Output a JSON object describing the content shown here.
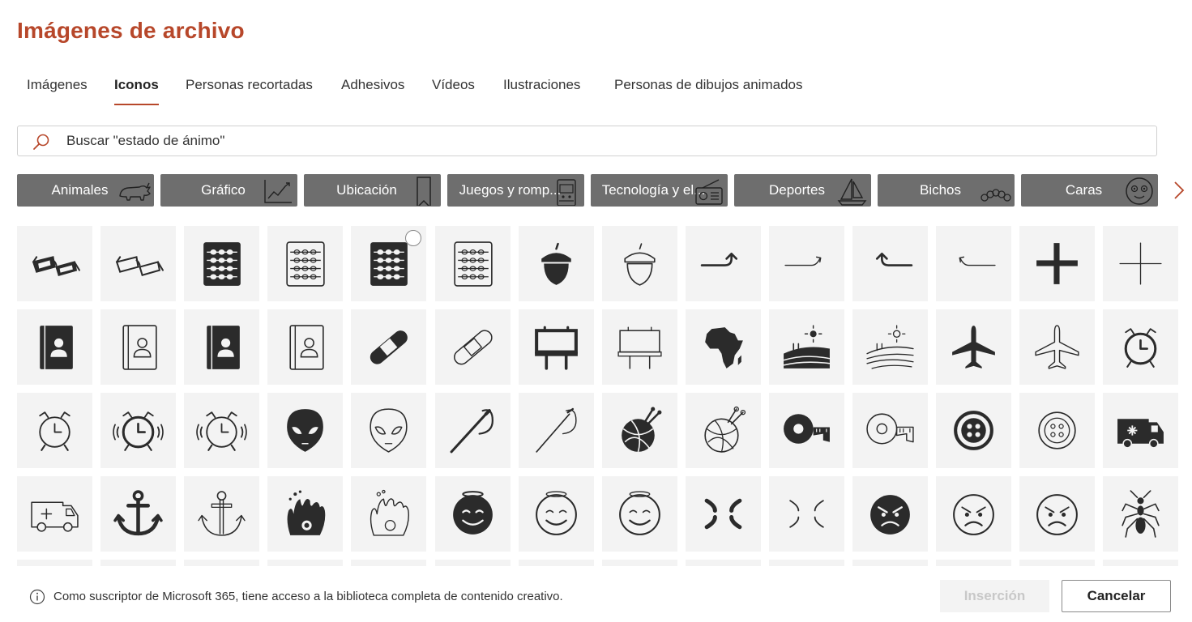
{
  "dialog": {
    "title": "Imágenes de archivo"
  },
  "tabs": [
    {
      "label": "Imágenes",
      "active": false
    },
    {
      "label": "Iconos",
      "active": true
    },
    {
      "label": "Personas recortadas",
      "active": false
    },
    {
      "label": "Adhesivos",
      "active": false
    },
    {
      "label": "Vídeos",
      "active": false
    },
    {
      "label": "Ilustraciones",
      "active": false
    },
    {
      "label": "Personas de dibujos animados",
      "active": false
    }
  ],
  "search": {
    "placeholder": "Buscar \"estado de ánimo\"",
    "value": ""
  },
  "categories": [
    {
      "label": "Animales",
      "icon": "rhino-icon"
    },
    {
      "label": "Gráfico",
      "icon": "line-chart-icon"
    },
    {
      "label": "Ubicación",
      "icon": "bookmark-icon"
    },
    {
      "label": "Juegos y romp...",
      "icon": "arcade-machine-icon"
    },
    {
      "label": "Tecnología y el...",
      "icon": "radio-icon"
    },
    {
      "label": "Deportes",
      "icon": "sailboat-icon"
    },
    {
      "label": "Bichos",
      "icon": "caterpillar-icon"
    },
    {
      "label": "Caras",
      "icon": "dizzy-face-icon"
    }
  ],
  "icon_tiles": [
    [
      "3d-glasses-filled-icon",
      "3d-glasses-outline-icon",
      "abacus-filled-icon",
      "abacus-outline-icon",
      "abacus-filled-icon",
      "abacus-outline-icon",
      "acorn-filled-icon",
      "acorn-outline-icon",
      "turn-right-arrow-filled-icon",
      "turn-right-arrow-outline-icon",
      "turn-left-arrow-filled-icon",
      "turn-left-arrow-outline-icon",
      "plus-filled-icon",
      "plus-outline-icon"
    ],
    [
      "address-book-filled-icon",
      "address-book-outline-icon",
      "address-book-filled-icon",
      "address-book-outline-icon",
      "bandage-filled-icon",
      "bandage-outline-icon",
      "billboard-filled-icon",
      "billboard-outline-icon",
      "africa-map-icon",
      "farm-landscape-filled-icon",
      "farm-landscape-outline-icon",
      "airplane-filled-icon",
      "airplane-outline-icon",
      "alarm-clock-filled-icon"
    ],
    [
      "alarm-clock-outline-icon",
      "alarm-ringing-filled-icon",
      "alarm-ringing-outline-icon",
      "alien-face-filled-icon",
      "alien-face-outline-icon",
      "needle-thread-filled-icon",
      "needle-thread-outline-icon",
      "yarn-ball-filled-icon",
      "yarn-ball-outline-icon",
      "measuring-tape-filled-icon",
      "measuring-tape-outline-icon",
      "button-filled-icon",
      "button-outline-icon",
      "ambulance-filled-icon"
    ],
    [
      "ambulance-outline-icon",
      "anchor-filled-icon",
      "anchor-outline-icon",
      "sea-anemone-filled-icon",
      "sea-anemone-outline-icon",
      "angel-face-filled-icon",
      "angel-face-outline-icon",
      "angel-face-outline-icon",
      "anger-symbol-filled-icon",
      "anger-symbol-outline-icon",
      "angry-face-filled-icon",
      "angry-face-outline-icon",
      "angry-face-outline-icon",
      "ant-icon"
    ]
  ],
  "footer": {
    "info": "Como suscriptor de Microsoft 365, tiene acceso a la biblioteca completa de contenido creativo.",
    "insert_label": "Inserción",
    "cancel_label": "Cancelar"
  },
  "colors": {
    "accent": "#b7472a",
    "chip_bg": "#6e6e6e",
    "tile_bg": "#f3f3f3",
    "icon": "#2b2b2b"
  }
}
